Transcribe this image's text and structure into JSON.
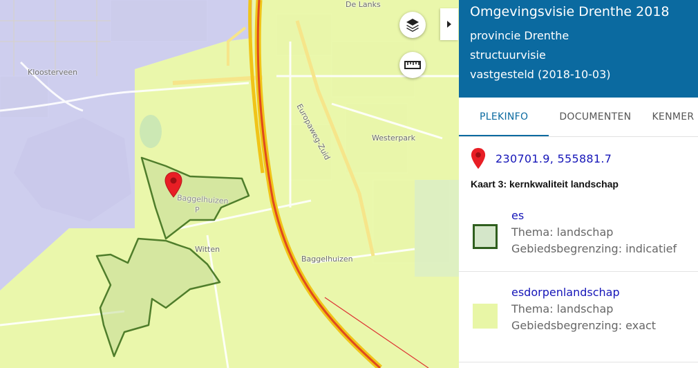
{
  "map": {
    "labels": {
      "kloosterveen": "Kloosterveen",
      "de_lanks": "De Lanks",
      "europaweg": "Europaweg-Zuid",
      "westerpark": "Westerpark",
      "baggelhuizen_park": "Baggelhuizen",
      "park_suffix": "P",
      "witten": "Witten",
      "baggelhuizen": "Baggelhuizen"
    },
    "controls": {
      "layers_icon": "layers-icon",
      "measure_icon": "ruler-icon",
      "toggle_icon": "chevron-right-icon"
    },
    "colors": {
      "land": "#f0eee8",
      "residential": "#e4e1d9",
      "light_green_zone": "#e8f6a6",
      "lavender_zone": "#c9c8ee",
      "es_fill": "#c7e09a",
      "es_stroke": "#4f7d2b",
      "highway": "#e14b1d",
      "highway_casing": "#f0c419",
      "water": "#bfdaf0"
    },
    "marker_icon": "map-pin-icon"
  },
  "panel": {
    "title": "Omgevingsvisie Drenthe 2018",
    "authority": "provincie Drenthe",
    "type": "structuurvisie",
    "status": "vastgesteld (2018-10-03)",
    "tabs": [
      "PLEKINFO",
      "DOCUMENTEN",
      "KENMER"
    ],
    "active_tab": "PLEKINFO",
    "location_icon": "map-pin-icon",
    "coordinates": "230701.9, 555881.7",
    "map_title": "Kaart 3: kernkwaliteit landschap",
    "features": [
      {
        "name": "es",
        "thema": "Thema: landschap",
        "begrenzing": "Gebiedsbegrenzing: indicatief",
        "swatch_fill": "#d4e6c9",
        "swatch_border": "#2f5e1e"
      },
      {
        "name": "esdorpenlandschap",
        "thema": "Thema: landschap",
        "begrenzing": "Gebiedsbegrenzing: exact",
        "swatch_fill": "#e8f6a6",
        "swatch_border": "#e8f6a6"
      }
    ],
    "colors": {
      "header_bg": "#0b6aa0",
      "link": "#1515b8",
      "tab_active": "#0b6aa0"
    }
  }
}
